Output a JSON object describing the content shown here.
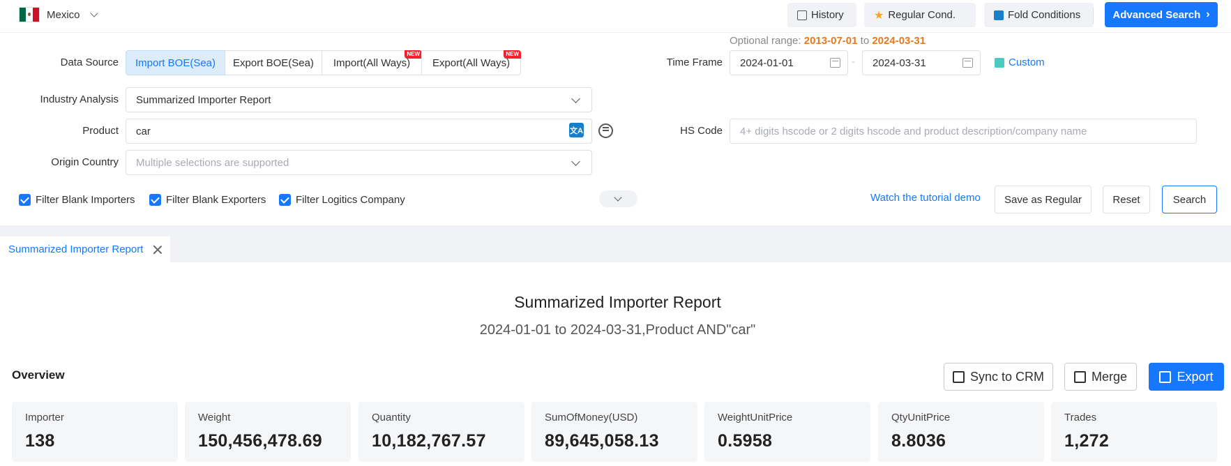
{
  "topbar": {
    "country": "Mexico",
    "history": "History",
    "regular_cond": "Regular Cond.",
    "fold_conditions": "Fold Conditions",
    "advanced_search": "Advanced Search"
  },
  "form": {
    "data_source_label": "Data Source",
    "data_sources": [
      "Import BOE(Sea)",
      "Export BOE(Sea)",
      "Import(All Ways)",
      "Export(All Ways)"
    ],
    "new_badge": "NEW",
    "optional_range_label": "Optional range:",
    "optional_range_from": "2013-07-01",
    "optional_range_to_word": "to",
    "optional_range_to": "2024-03-31",
    "time_frame_label": "Time Frame",
    "date_from": "2024-01-01",
    "date_sep": "-",
    "date_to": "2024-03-31",
    "custom": "Custom",
    "industry_label": "Industry Analysis",
    "industry_value": "Summarized Importer Report",
    "product_label": "Product",
    "product_value": "car",
    "hs_label": "HS Code",
    "hs_placeholder": "4+ digits hscode or 2 digits hscode and product description/company name",
    "origin_label": "Origin Country",
    "origin_placeholder": "Multiple selections are supported",
    "filters": [
      "Filter Blank Importers",
      "Filter Blank Exporters",
      "Filter Logitics Company"
    ],
    "tutorial": "Watch the tutorial demo",
    "save_regular": "Save as Regular",
    "reset": "Reset",
    "search": "Search"
  },
  "tab": {
    "label": "Summarized Importer Report"
  },
  "report": {
    "title": "Summarized Importer Report",
    "subtitle": "2024-01-01 to 2024-03-31,Product AND\"car\"",
    "overview": "Overview",
    "sync_crm": "Sync to CRM",
    "merge": "Merge",
    "export": "Export",
    "stats": [
      {
        "label": "Importer",
        "value": "138"
      },
      {
        "label": "Weight",
        "value": "150,456,478.69"
      },
      {
        "label": "Quantity",
        "value": "10,182,767.57"
      },
      {
        "label": "SumOfMoney(USD)",
        "value": "89,645,058.13"
      },
      {
        "label": "WeightUnitPrice",
        "value": "0.5958"
      },
      {
        "label": "QtyUnitPrice",
        "value": "8.8036"
      },
      {
        "label": "Trades",
        "value": "1,272"
      }
    ]
  },
  "colors": {
    "accent": "#1677ff",
    "range": "#e5791e"
  }
}
